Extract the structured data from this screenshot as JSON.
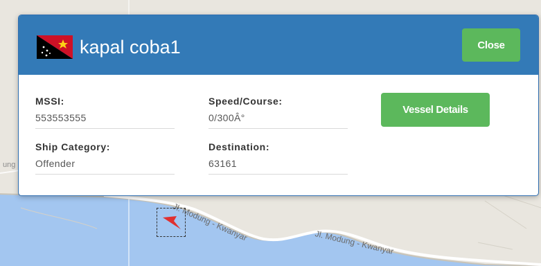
{
  "popup": {
    "title": "kapal coba1",
    "flag_icon": "papua-new-guinea-flag-icon",
    "close_label": "Close",
    "details_label": "Vessel Details",
    "fields": {
      "mmsi": {
        "label": "MSSI:",
        "value": "553553555"
      },
      "speed": {
        "label": "Speed/Course:",
        "value": "0/300Â°"
      },
      "category": {
        "label": "Ship Category:",
        "value": "Offender"
      },
      "destination": {
        "label": "Destination:",
        "value": "63161"
      }
    }
  },
  "map": {
    "road_labels": [
      "ung",
      "Jl. Modung - Kwanyar",
      "Jl. Modung - Kwanyar"
    ],
    "vessel_marker_icon": "vessel-arrow-icon",
    "colors": {
      "land": "#e9e6df",
      "sea": "#a3c6f0",
      "vessel": "#e03030"
    }
  },
  "colors": {
    "header": "#337ab7",
    "button": "#5cb85c"
  }
}
